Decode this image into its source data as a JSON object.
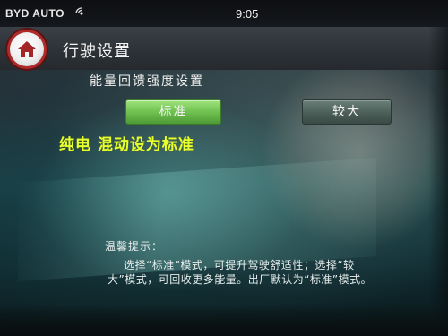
{
  "status_bar": {
    "brand": "BYD AUTO",
    "time": "9:05",
    "signal_icon": "wireless-signal-icon"
  },
  "header": {
    "home_icon": "home-icon",
    "title": "行驶设置"
  },
  "main": {
    "section_heading": "能量回馈强度设置",
    "options": [
      {
        "label": "标准",
        "selected": true
      },
      {
        "label": "较大",
        "selected": false
      }
    ],
    "annotation": "纯电  混动设为标准",
    "tip": {
      "title": "温馨提示：",
      "line1": "选择“标准”模式，可提升驾驶舒适性；选择“较",
      "line2": "大”模式，可回收更多能量。出厂默认为“标准”模式。"
    }
  },
  "colors": {
    "selected_option": "#6fc150",
    "unselected_option": "#4c5e58",
    "annotation_text": "#e8ff2e",
    "home_ring": "#b02a2a"
  }
}
